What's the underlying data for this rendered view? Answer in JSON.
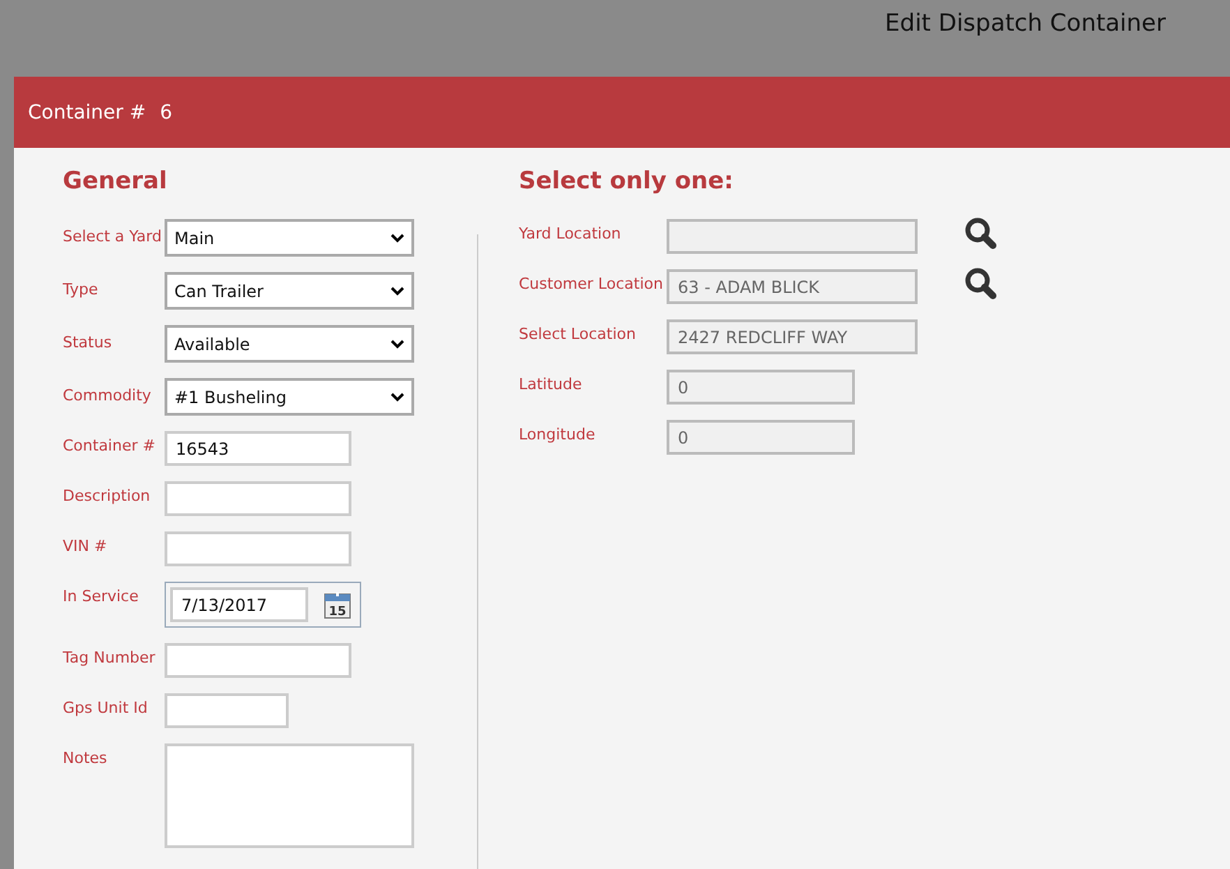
{
  "window": {
    "title": "Edit Dispatch Container"
  },
  "header": {
    "label": "Container #",
    "value": "6"
  },
  "general": {
    "title": "General",
    "fields": [
      {
        "label": "Select a Yard",
        "kind": "select",
        "value": "Main"
      },
      {
        "label": "Type",
        "kind": "select",
        "value": "Can Trailer"
      },
      {
        "label": "Status",
        "kind": "select",
        "value": "Available"
      },
      {
        "label": "Commodity",
        "kind": "select",
        "value": "#1 Busheling"
      },
      {
        "label": "Container #",
        "kind": "text",
        "value": "16543"
      },
      {
        "label": "Description",
        "kind": "text"
      },
      {
        "label": "VIN #",
        "kind": "text"
      },
      {
        "label": "In Service",
        "kind": "date",
        "value": "7/13/2017",
        "calendar_day": "15"
      },
      {
        "label": "Tag Number",
        "kind": "text"
      },
      {
        "label": "Gps Unit Id",
        "kind": "short-text"
      },
      {
        "label": "Notes",
        "kind": "textarea"
      }
    ]
  },
  "location": {
    "title": "Select only one:",
    "fields": [
      {
        "label": "Yard Location",
        "kind": "lookup",
        "disabled": true
      },
      {
        "label": "Customer Location",
        "kind": "lookup",
        "value": "63 - ADAM BLICK",
        "disabled": true
      },
      {
        "label": "Select Location",
        "kind": "text",
        "value": "2427 REDCLIFF WAY",
        "disabled": true
      },
      {
        "label": "Latitude",
        "kind": "short-text",
        "value": "0",
        "disabled": true
      },
      {
        "label": "Longitude",
        "kind": "short-text",
        "value": "0",
        "disabled": true
      }
    ]
  }
}
